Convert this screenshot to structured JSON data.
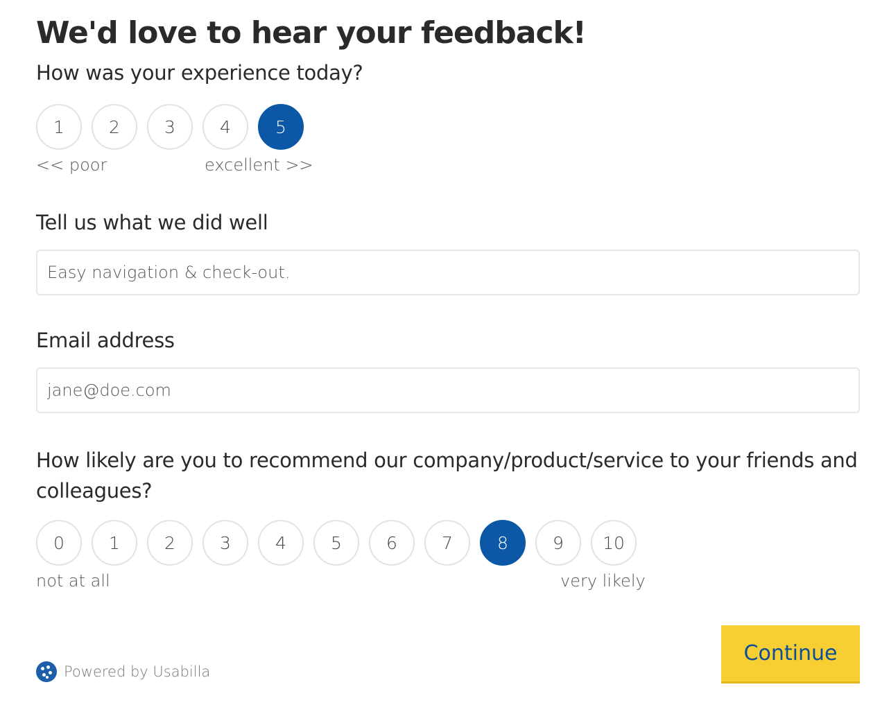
{
  "title": "We'd love to hear your feedback!",
  "experience": {
    "question": "How was your experience today?",
    "options": [
      "1",
      "2",
      "3",
      "4",
      "5"
    ],
    "selected": "5",
    "min_label": "<< poor",
    "max_label": "excellent >>"
  },
  "did_well": {
    "label": "Tell us what we did well",
    "value": "Easy navigation & check-out."
  },
  "email": {
    "label": "Email address",
    "value": "jane@doe.com"
  },
  "nps": {
    "question": "How likely are you to recommend our company/product/service to your friends and colleagues?",
    "options": [
      "0",
      "1",
      "2",
      "3",
      "4",
      "5",
      "6",
      "7",
      "8",
      "9",
      "10"
    ],
    "selected": "8",
    "min_label": "not at all",
    "max_label": "very likely"
  },
  "footer": {
    "powered_by": "Powered by Usabilla"
  },
  "continue_label": "Continue",
  "colors": {
    "accent": "#0c57a6",
    "button": "#f7cf32",
    "button_text": "#0c4f96"
  },
  "icons": {
    "brand": "usabilla-logo-icon"
  }
}
